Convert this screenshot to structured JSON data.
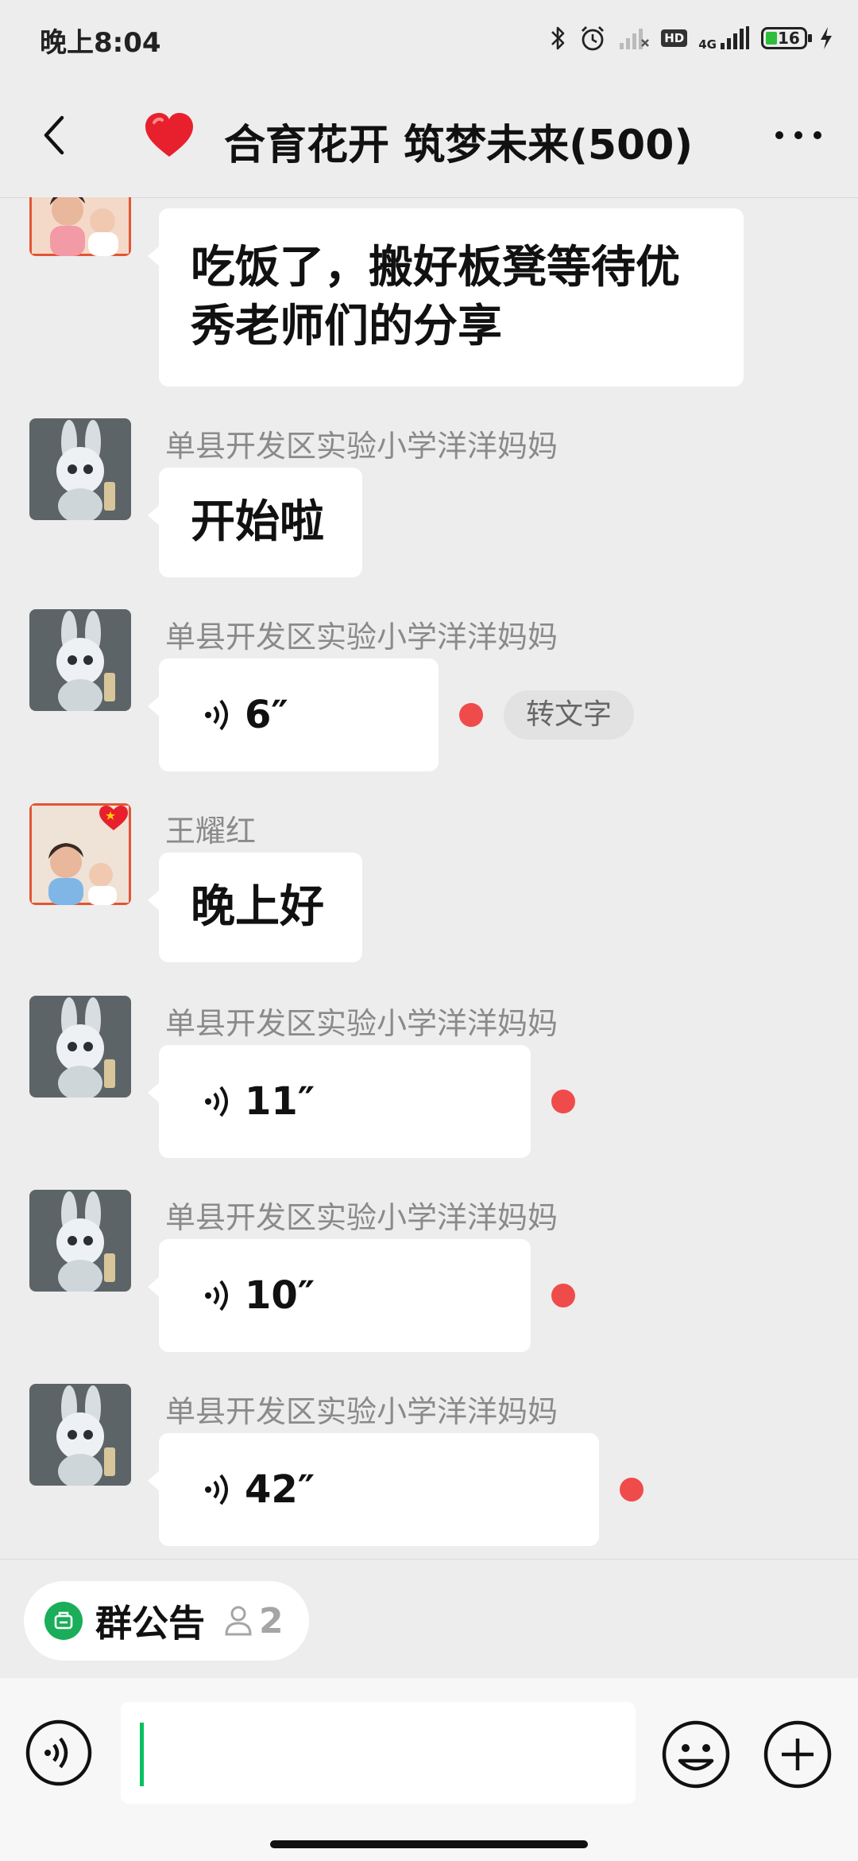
{
  "status_bar": {
    "time": "晚上8:04",
    "network": "4G",
    "hd": "HD",
    "battery": "16"
  },
  "nav": {
    "back_icon": "back-arrow-icon",
    "emoji": "red-heart",
    "title": "合育花开 筑梦未来(500)",
    "more_icon": "more-dots-icon"
  },
  "messages": [
    {
      "sender": "",
      "type": "text",
      "lines": [
        "吃饭了，搬好板凳等待优",
        "秀老师们的分享"
      ]
    },
    {
      "sender": "单县开发区实验小学洋洋妈妈",
      "type": "text",
      "lines": [
        "开始啦"
      ]
    },
    {
      "sender": "单县开发区实验小学洋洋妈妈",
      "type": "voice",
      "duration": "6″",
      "action": "转文字"
    },
    {
      "sender": "王耀红",
      "type": "text",
      "lines": [
        "晚上好"
      ]
    },
    {
      "sender": "单县开发区实验小学洋洋妈妈",
      "type": "voice",
      "duration": "11″"
    },
    {
      "sender": "单县开发区实验小学洋洋妈妈",
      "type": "voice",
      "duration": "10″"
    },
    {
      "sender": "单县开发区实验小学洋洋妈妈",
      "type": "voice",
      "duration": "42″"
    }
  ],
  "announcement": {
    "label": "群公告",
    "count": "2"
  },
  "input": {
    "value": ""
  },
  "colors": {
    "accent": "#07C160",
    "unread_dot": "#F04B4B",
    "background": "#EDEDED"
  }
}
